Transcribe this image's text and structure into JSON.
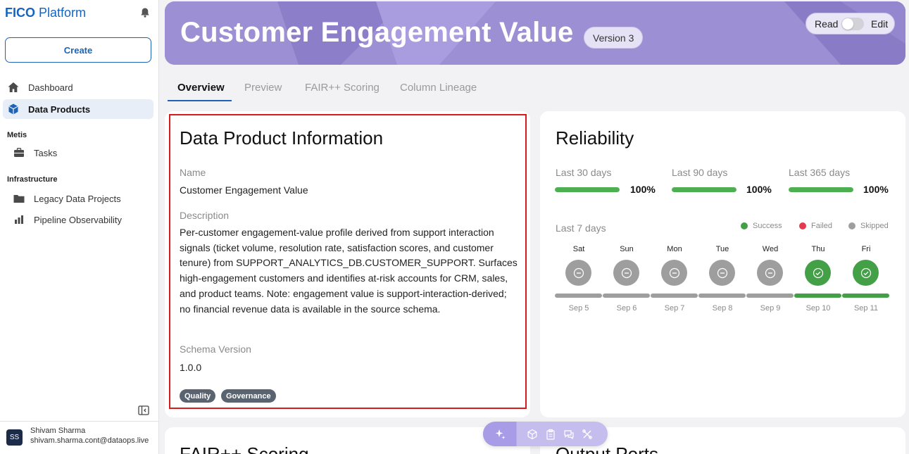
{
  "brand": {
    "bold": "FICO",
    "rest": " Platform"
  },
  "sidebar": {
    "create_label": "Create",
    "items": [
      {
        "label": "Dashboard",
        "icon": "home-icon"
      },
      {
        "label": "Data Products",
        "icon": "cube-icon"
      }
    ],
    "sections": [
      {
        "label": "Metis",
        "items": [
          {
            "label": "Tasks",
            "icon": "briefcase-icon"
          }
        ]
      },
      {
        "label": "Infrastructure",
        "items": [
          {
            "label": "Legacy Data Projects",
            "icon": "folder-icon"
          },
          {
            "label": "Pipeline Observability",
            "icon": "bar-chart-icon"
          }
        ]
      }
    ],
    "user": {
      "initials": "SS",
      "name": "Shivam Sharma",
      "email": "shivam.sharma.cont@dataops.live"
    }
  },
  "hero": {
    "title": "Customer Engagement Value",
    "version": "Version 3",
    "read_label": "Read",
    "edit_label": "Edit"
  },
  "tabs": [
    "Overview",
    "Preview",
    "FAIR++ Scoring",
    "Column Lineage"
  ],
  "info": {
    "title": "Data Product Information",
    "name_label": "Name",
    "name_value": "Customer Engagement Value",
    "description_label": "Description",
    "description_value": "Per-customer engagement-value profile derived from support interaction signals (ticket volume, resolution rate, satisfaction scores, and customer tenure) from SUPPORT_ANALYTICS_DB.CUSTOMER_SUPPORT. Surfaces high-engagement customers and identifies at-risk accounts for CRM, sales, and product teams. Note: engagement value is support-interaction-derived; no financial revenue data is available in the source schema.",
    "schema_label": "Schema Version",
    "schema_value": "1.0.0",
    "tags": [
      "Quality",
      "Governance"
    ]
  },
  "reliability": {
    "title": "Reliability",
    "periods": [
      {
        "label": "Last 30 days",
        "value": "100%",
        "fraction": 1.0
      },
      {
        "label": "Last 90 days",
        "value": "100%",
        "fraction": 1.0
      },
      {
        "label": "Last 365 days",
        "value": "100%",
        "fraction": 1.0
      }
    ],
    "last7_label": "Last 7 days",
    "legend": [
      {
        "label": "Success",
        "color": "#43a047"
      },
      {
        "label": "Failed",
        "color": "#e53950"
      },
      {
        "label": "Skipped",
        "color": "#9e9e9e"
      }
    ],
    "days": [
      {
        "day": "Sat",
        "date": "Sep 5",
        "status": "skipped"
      },
      {
        "day": "Sun",
        "date": "Sep 6",
        "status": "skipped"
      },
      {
        "day": "Mon",
        "date": "Sep 7",
        "status": "skipped"
      },
      {
        "day": "Tue",
        "date": "Sep 8",
        "status": "skipped"
      },
      {
        "day": "Wed",
        "date": "Sep 9",
        "status": "skipped"
      },
      {
        "day": "Thu",
        "date": "Sep 10",
        "status": "success"
      },
      {
        "day": "Fri",
        "date": "Sep 11",
        "status": "success"
      }
    ]
  },
  "bottom": {
    "left_title": "FAIR++ Scoring",
    "right_title": "Output Ports"
  },
  "colors": {
    "accent": "#1e63b5",
    "hero": "#9d8fd3",
    "success": "#43a047",
    "skipped": "#9e9e9e",
    "highlight": "#d41c1c"
  }
}
